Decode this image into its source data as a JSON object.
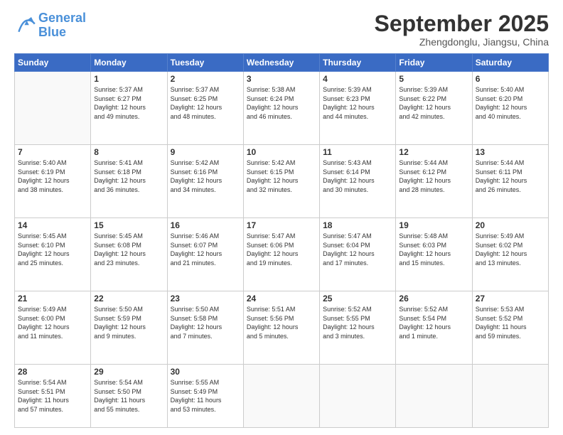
{
  "header": {
    "logo_line1": "General",
    "logo_line2": "Blue",
    "month_title": "September 2025",
    "location": "Zhengdonglu, Jiangsu, China"
  },
  "weekdays": [
    "Sunday",
    "Monday",
    "Tuesday",
    "Wednesday",
    "Thursday",
    "Friday",
    "Saturday"
  ],
  "weeks": [
    [
      {
        "day": "",
        "info": ""
      },
      {
        "day": "1",
        "info": "Sunrise: 5:37 AM\nSunset: 6:27 PM\nDaylight: 12 hours\nand 49 minutes."
      },
      {
        "day": "2",
        "info": "Sunrise: 5:37 AM\nSunset: 6:25 PM\nDaylight: 12 hours\nand 48 minutes."
      },
      {
        "day": "3",
        "info": "Sunrise: 5:38 AM\nSunset: 6:24 PM\nDaylight: 12 hours\nand 46 minutes."
      },
      {
        "day": "4",
        "info": "Sunrise: 5:39 AM\nSunset: 6:23 PM\nDaylight: 12 hours\nand 44 minutes."
      },
      {
        "day": "5",
        "info": "Sunrise: 5:39 AM\nSunset: 6:22 PM\nDaylight: 12 hours\nand 42 minutes."
      },
      {
        "day": "6",
        "info": "Sunrise: 5:40 AM\nSunset: 6:20 PM\nDaylight: 12 hours\nand 40 minutes."
      }
    ],
    [
      {
        "day": "7",
        "info": "Sunrise: 5:40 AM\nSunset: 6:19 PM\nDaylight: 12 hours\nand 38 minutes."
      },
      {
        "day": "8",
        "info": "Sunrise: 5:41 AM\nSunset: 6:18 PM\nDaylight: 12 hours\nand 36 minutes."
      },
      {
        "day": "9",
        "info": "Sunrise: 5:42 AM\nSunset: 6:16 PM\nDaylight: 12 hours\nand 34 minutes."
      },
      {
        "day": "10",
        "info": "Sunrise: 5:42 AM\nSunset: 6:15 PM\nDaylight: 12 hours\nand 32 minutes."
      },
      {
        "day": "11",
        "info": "Sunrise: 5:43 AM\nSunset: 6:14 PM\nDaylight: 12 hours\nand 30 minutes."
      },
      {
        "day": "12",
        "info": "Sunrise: 5:44 AM\nSunset: 6:12 PM\nDaylight: 12 hours\nand 28 minutes."
      },
      {
        "day": "13",
        "info": "Sunrise: 5:44 AM\nSunset: 6:11 PM\nDaylight: 12 hours\nand 26 minutes."
      }
    ],
    [
      {
        "day": "14",
        "info": "Sunrise: 5:45 AM\nSunset: 6:10 PM\nDaylight: 12 hours\nand 25 minutes."
      },
      {
        "day": "15",
        "info": "Sunrise: 5:45 AM\nSunset: 6:08 PM\nDaylight: 12 hours\nand 23 minutes."
      },
      {
        "day": "16",
        "info": "Sunrise: 5:46 AM\nSunset: 6:07 PM\nDaylight: 12 hours\nand 21 minutes."
      },
      {
        "day": "17",
        "info": "Sunrise: 5:47 AM\nSunset: 6:06 PM\nDaylight: 12 hours\nand 19 minutes."
      },
      {
        "day": "18",
        "info": "Sunrise: 5:47 AM\nSunset: 6:04 PM\nDaylight: 12 hours\nand 17 minutes."
      },
      {
        "day": "19",
        "info": "Sunrise: 5:48 AM\nSunset: 6:03 PM\nDaylight: 12 hours\nand 15 minutes."
      },
      {
        "day": "20",
        "info": "Sunrise: 5:49 AM\nSunset: 6:02 PM\nDaylight: 12 hours\nand 13 minutes."
      }
    ],
    [
      {
        "day": "21",
        "info": "Sunrise: 5:49 AM\nSunset: 6:00 PM\nDaylight: 12 hours\nand 11 minutes."
      },
      {
        "day": "22",
        "info": "Sunrise: 5:50 AM\nSunset: 5:59 PM\nDaylight: 12 hours\nand 9 minutes."
      },
      {
        "day": "23",
        "info": "Sunrise: 5:50 AM\nSunset: 5:58 PM\nDaylight: 12 hours\nand 7 minutes."
      },
      {
        "day": "24",
        "info": "Sunrise: 5:51 AM\nSunset: 5:56 PM\nDaylight: 12 hours\nand 5 minutes."
      },
      {
        "day": "25",
        "info": "Sunrise: 5:52 AM\nSunset: 5:55 PM\nDaylight: 12 hours\nand 3 minutes."
      },
      {
        "day": "26",
        "info": "Sunrise: 5:52 AM\nSunset: 5:54 PM\nDaylight: 12 hours\nand 1 minute."
      },
      {
        "day": "27",
        "info": "Sunrise: 5:53 AM\nSunset: 5:52 PM\nDaylight: 11 hours\nand 59 minutes."
      }
    ],
    [
      {
        "day": "28",
        "info": "Sunrise: 5:54 AM\nSunset: 5:51 PM\nDaylight: 11 hours\nand 57 minutes."
      },
      {
        "day": "29",
        "info": "Sunrise: 5:54 AM\nSunset: 5:50 PM\nDaylight: 11 hours\nand 55 minutes."
      },
      {
        "day": "30",
        "info": "Sunrise: 5:55 AM\nSunset: 5:49 PM\nDaylight: 11 hours\nand 53 minutes."
      },
      {
        "day": "",
        "info": ""
      },
      {
        "day": "",
        "info": ""
      },
      {
        "day": "",
        "info": ""
      },
      {
        "day": "",
        "info": ""
      }
    ]
  ]
}
